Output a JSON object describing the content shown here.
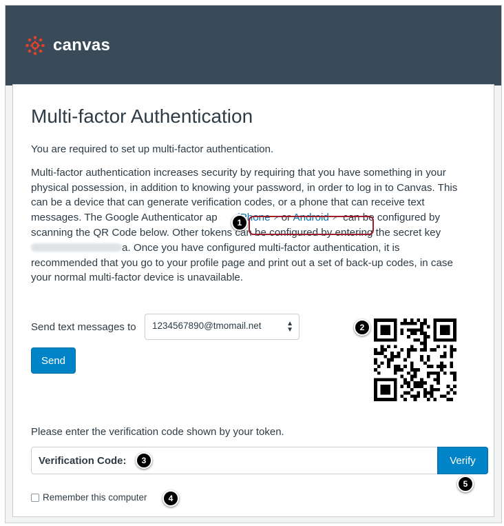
{
  "app": {
    "logo_text": "canvas",
    "brand_color": "#e4412c",
    "header_color": "#394b58"
  },
  "page": {
    "title": "Multi-factor Authentication",
    "requirement": "You are required to set up multi-factor authentication.",
    "paragraph": {
      "line1": "Multi-factor authentication increases security by requiring that you have something in your",
      "line2": "physical possession, in addition to knowing your password, in order to log in to Canvas. This",
      "line3": "can be a device that can generate verification codes, or a phone that can receive text",
      "line4_pre": "messages. The Google Authenticator ap",
      "iphone_link": "iPhone",
      "or": "or",
      "android_link": "Android",
      "line4_post": "can be configured by",
      "line5": "scanning the QR Code below. Other tokens can be configured by entering the secret key",
      "line6_post": "a. Once you have configured multi-factor authentication, it is",
      "line7": "recommended that you go to your profile page and print out a set of back-up codes, in case",
      "line8": "your normal multi-factor device is unavailable."
    }
  },
  "sms": {
    "label": "Send text messages to",
    "selected_option": "1234567890@tmomail.net",
    "send_button": "Send"
  },
  "verification": {
    "prompt": "Please enter the verification code shown by your token.",
    "code_label": "Verification Code:",
    "code_value": "",
    "verify_button": "Verify",
    "remember_label": "Remember this computer",
    "remember_checked": false
  },
  "callouts": [
    "1",
    "2",
    "3",
    "4",
    "5"
  ],
  "colors": {
    "link": "#0770a3",
    "button": "#0084c7",
    "highlight": "#9c1c2a"
  },
  "icons": {
    "external_link": "external-link-icon",
    "select_arrows": "chevron-updown-icon",
    "qr": "qr-code-icon"
  }
}
